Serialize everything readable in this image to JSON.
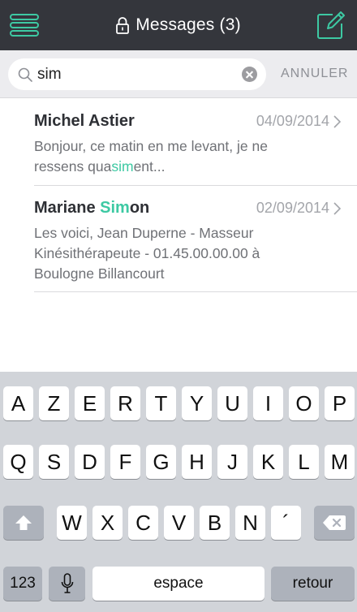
{
  "header": {
    "title": "Messages (3)",
    "accent_color": "#3dc9a3",
    "background_color": "#34363c",
    "icons": [
      "hamburger-menu-icon",
      "lock-icon",
      "compose-icon"
    ]
  },
  "search": {
    "value": "sim",
    "cancel_label": "ANNULER",
    "icons": [
      "search-icon",
      "clear-icon"
    ]
  },
  "messages": [
    {
      "sender_parts": [
        "Michel Astier",
        "",
        ""
      ],
      "date": "04/09/2014",
      "preview_parts": [
        "Bonjour, ce matin en me levant, je ne ressens qua",
        "sim",
        "ent..."
      ]
    },
    {
      "sender_parts": [
        "Mariane ",
        "Sim",
        "on"
      ],
      "date": "02/09/2014",
      "preview_parts": [
        "Les voici, Jean Duperne - Masseur Kinésithérapeute - 01.45.00.00.00 à Boulogne Billancourt",
        "",
        ""
      ]
    }
  ],
  "keyboard": {
    "row1": [
      "A",
      "Z",
      "E",
      "R",
      "T",
      "Y",
      "U",
      "I",
      "O",
      "P"
    ],
    "row2": [
      "Q",
      "S",
      "D",
      "F",
      "G",
      "H",
      "J",
      "K",
      "L",
      "M"
    ],
    "row3": [
      "W",
      "X",
      "C",
      "V",
      "B",
      "N",
      "´"
    ],
    "numbers_label": "123",
    "space_label": "espace",
    "return_label": "retour",
    "icons": [
      "shift-icon",
      "backspace-icon",
      "microphone-icon"
    ]
  }
}
